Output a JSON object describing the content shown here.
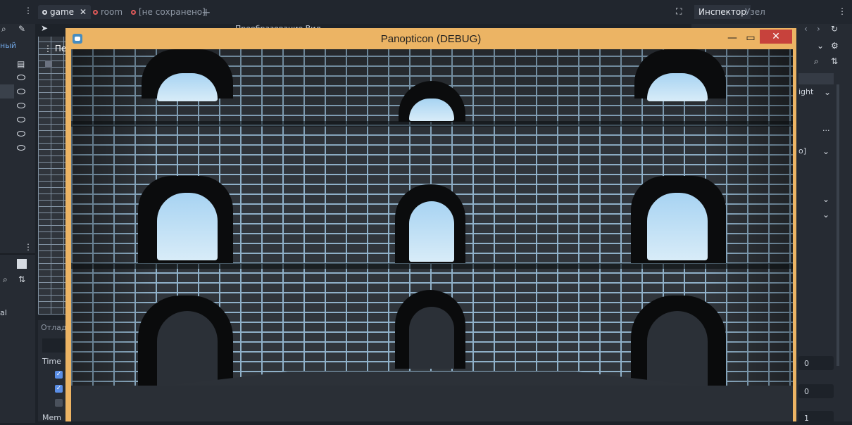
{
  "editor": {
    "tabs": [
      {
        "label": "game",
        "active": true
      },
      {
        "label": "room",
        "active": false
      },
      {
        "label": "[не сохранено]",
        "active": false
      }
    ],
    "left_label": "ный",
    "toolbar_text": "Преобразование  Вид",
    "left_text": "al",
    "debug_tab": "Отлад",
    "debug_items": [
      "Time",
      "Mem"
    ],
    "viewport_label": "Пе"
  },
  "inspector": {
    "tabs": [
      "Инспектор",
      "Узел"
    ],
    "fragment_right": "ight",
    "fragment_bracket": "o]",
    "values": [
      "0",
      "0",
      "1"
    ],
    "more": "..."
  },
  "game_window": {
    "title": "Panopticon (DEBUG)",
    "minimize": "—",
    "maximize": "▭",
    "close": "✕"
  },
  "colors": {
    "title_bar": "#ecb464",
    "close_button": "#c7423c",
    "brick_mortar": "#8fb0c8",
    "sky": "#bfe0f5"
  }
}
